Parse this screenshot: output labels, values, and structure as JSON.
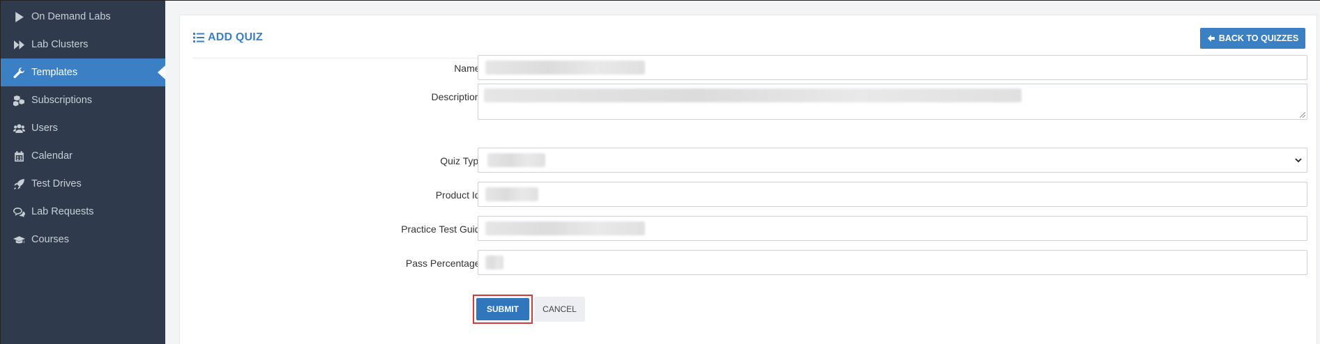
{
  "sidebar": {
    "items": [
      {
        "label": "On Demand Labs",
        "icon": "play-icon"
      },
      {
        "label": "Lab Clusters",
        "icon": "fast-forward-icon"
      },
      {
        "label": "Templates",
        "icon": "wrench-icon",
        "active": true
      },
      {
        "label": "Subscriptions",
        "icon": "cubes-icon"
      },
      {
        "label": "Users",
        "icon": "users-icon"
      },
      {
        "label": "Calendar",
        "icon": "calendar-icon"
      },
      {
        "label": "Test Drives",
        "icon": "rocket-icon"
      },
      {
        "label": "Lab Requests",
        "icon": "comments-icon"
      },
      {
        "label": "Courses",
        "icon": "graduation-cap-icon"
      }
    ]
  },
  "header": {
    "title": "ADD QUIZ",
    "back_label": "BACK TO QUIZZES"
  },
  "form": {
    "fields": [
      {
        "label": "Name",
        "required": "*"
      },
      {
        "label": "Description",
        "required": "*"
      },
      {
        "label": "Quiz Type",
        "required": ""
      },
      {
        "label": "Product Id",
        "required": "*"
      },
      {
        "label": "Practice Test Guid",
        "required": "*"
      },
      {
        "label": "Pass Percentage",
        "required": "*"
      }
    ],
    "submit_label": "SUBMIT",
    "cancel_label": "CANCEL"
  },
  "colors": {
    "sidebar_bg": "#2f3b4c",
    "accent": "#3b7fc4",
    "required": "#c9302c",
    "highlight": "#d9383a"
  }
}
